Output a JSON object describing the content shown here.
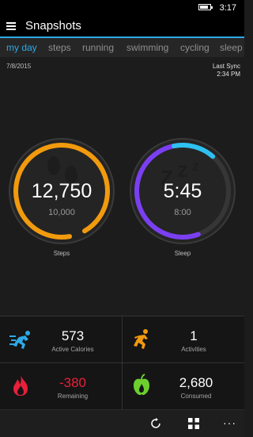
{
  "status": {
    "time": "3:17",
    "battery_level": 0.85
  },
  "header": {
    "title": "Snapshots"
  },
  "tabs": [
    "my day",
    "steps",
    "running",
    "swimming",
    "cycling",
    "sleep"
  ],
  "meta": {
    "date": "7/8/2015",
    "sync_label": "Last Sync",
    "sync_time": "2:34 PM"
  },
  "steps": {
    "value": "12,750",
    "goal": "10,000",
    "label": "Steps",
    "ring_color": "#f29a0e",
    "progress": 1.0
  },
  "sleep": {
    "value": "5:45",
    "goal": "8:00",
    "label": "Sleep",
    "ring_color": "#7b3ff2",
    "accent": "#2ec0f0",
    "progress": 0.72
  },
  "tiles": [
    {
      "value": "573",
      "label": "Active Calories",
      "icon": "running-person-icon",
      "color": "#2ea9e6"
    },
    {
      "value": "1",
      "label": "Activities",
      "icon": "runner-icon",
      "color": "#f29a0e"
    },
    {
      "value": "-380",
      "label": "Remaining",
      "icon": "flame-icon",
      "color": "#e8203a"
    },
    {
      "value": "2,680",
      "label": "Consumed",
      "icon": "apple-icon",
      "color": "#6ccf2e"
    }
  ],
  "bottombar": {
    "icons": [
      "sync-icon",
      "grid-icon",
      "more-icon"
    ]
  }
}
